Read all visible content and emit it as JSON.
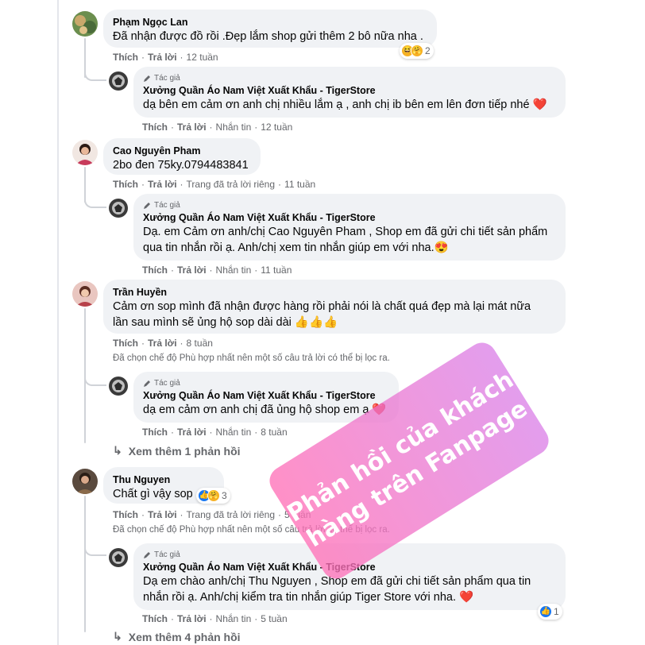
{
  "actions": {
    "like": "Thích",
    "reply": "Trả lời",
    "sent": "Nhắn tin"
  },
  "author_badge": "Tác giả",
  "page_name": "Xưởng Quần Áo Nam Việt Xuất Khẩu - TigerStore",
  "filter_note": "Đã chọn chế độ Phù hợp nhất nên một số câu trả lời có thể bị lọc ra.",
  "comments": [
    {
      "name": "Phạm Ngọc Lan",
      "text": "Đã nhận được đồ rồi .Đẹp lắm shop gửi thêm 2 bô nữa nha .",
      "time": "12 tuần",
      "reaction_count": "2",
      "reply": {
        "text": "dạ bên em cảm ơn anh chị nhiều lắm ạ , anh chị ib bên em lên đơn tiếp nhé ❤️",
        "time": "12 tuần"
      }
    },
    {
      "name": "Cao Nguyên Pham",
      "text": "2bo đen 75ky.0794483841",
      "time": "11 tuần",
      "status": "Trang đã trả lời riêng",
      "reply": {
        "text_line1": "Dạ. em Cảm ơn anh/chị Cao Nguyên Pham , Shop em đã gửi chi tiết sản phẩm",
        "text_line2": "qua tin nhắn rồi ạ. Anh/chị xem tin nhắn giúp em với nha.😍",
        "time": "11 tuần"
      }
    },
    {
      "name": "Trần Huyền",
      "text_line1": "Cảm ơn sop mình đã nhận được hàng rồi phải nói là chất quá đẹp mà lại mát nữa",
      "text_line2": "lần sau mình sẽ ủng hộ sop dài dài 👍👍👍",
      "time": "8 tuần",
      "reply": {
        "text": "dạ em cảm ơn anh chị đã ủng hộ shop em ạ ❤️",
        "time": "8 tuần"
      },
      "more_replies": "Xem thêm 1 phản hồi"
    },
    {
      "name": "Thu Nguyen",
      "text": "Chất gì vậy sop",
      "time": "5 tuần",
      "status": "Trang đã trả lời riêng",
      "reaction_count": "3",
      "reply": {
        "text_line1": "Dạ em chào anh/chị Thu Nguyen , Shop em đã gửi chi tiết sản phẩm qua tin",
        "text_line2": "nhắn rồi ạ. Anh/chị kiểm tra tin nhắn giúp Tiger Store với nha. ❤️",
        "time": "5 tuần",
        "reaction_count": "1"
      },
      "more_replies": "Xem thêm 4 phản hồi"
    }
  ],
  "watermark": {
    "line1": "Phản hồi của khách",
    "line2": "hàng trên Fanpage"
  },
  "colors": {
    "bubble": "#f0f2f5",
    "meta": "#65676b",
    "like": "#1877f2",
    "heart": "#e41e3f",
    "watermark": "#ff71b7"
  }
}
